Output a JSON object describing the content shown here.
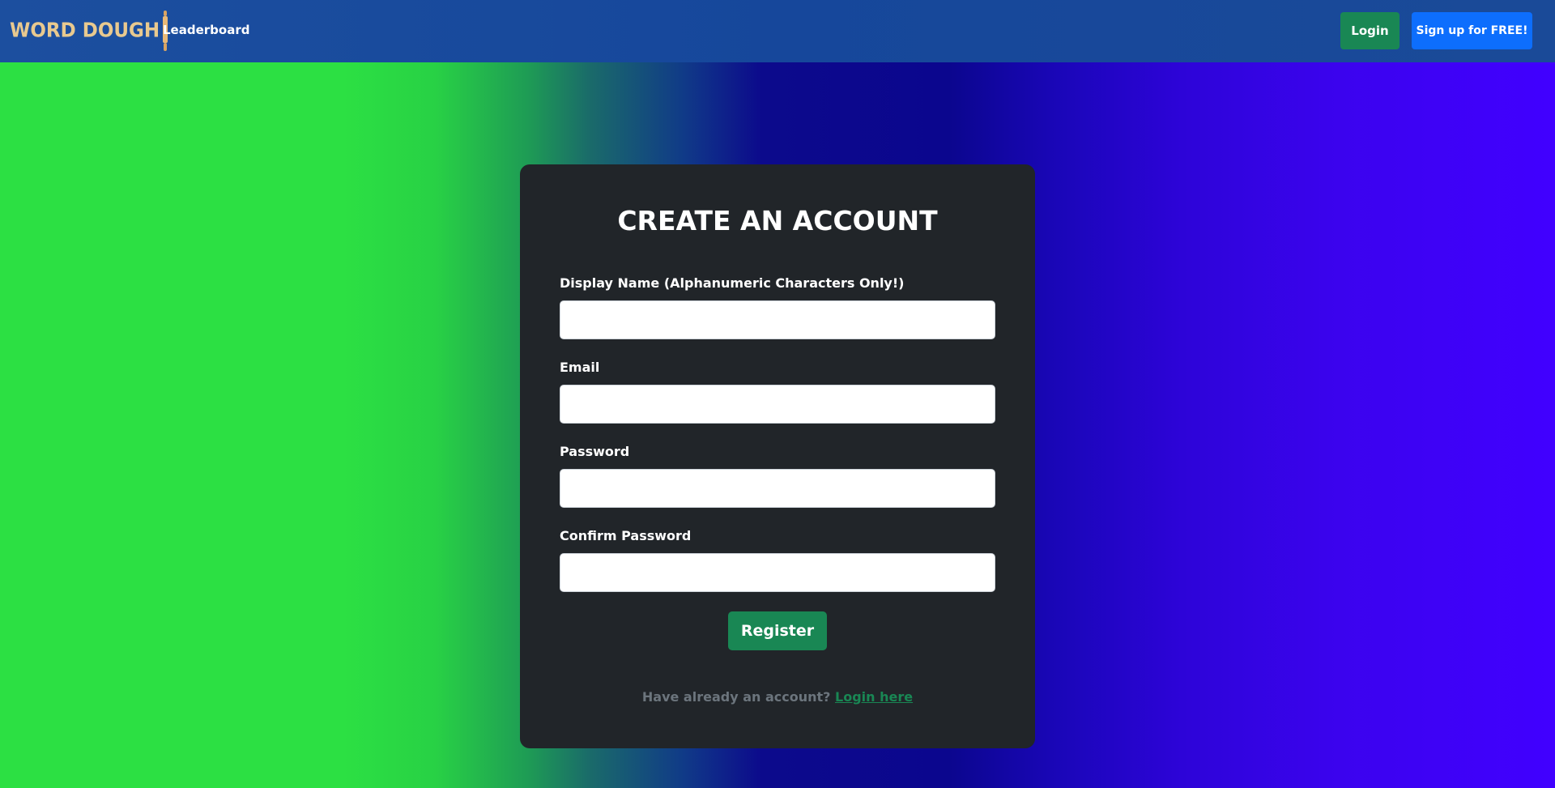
{
  "navbar": {
    "brand": "WORD DOUGH",
    "links": [
      {
        "label": "Leaderboard"
      }
    ],
    "login_label": "Login",
    "signup_label": "Sign up for FREE!"
  },
  "form": {
    "title": "CREATE AN ACCOUNT",
    "fields": [
      {
        "label": "Display Name (Alphanumeric Characters Only!)",
        "value": ""
      },
      {
        "label": "Email",
        "value": ""
      },
      {
        "label": "Password",
        "value": ""
      },
      {
        "label": "Confirm Password",
        "value": ""
      }
    ],
    "submit_label": "Register",
    "footer_text": "Have already an account?",
    "footer_link": "Login here"
  },
  "colors": {
    "navbar": "#16479b",
    "card": "#212529",
    "success": "#198754",
    "primary": "#0d6efd",
    "brand": "#e8c98f",
    "muted": "#6c757d"
  },
  "icons": {
    "brand_icon": "rolling-pin-icon"
  }
}
